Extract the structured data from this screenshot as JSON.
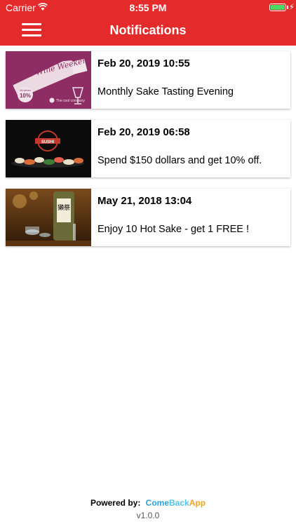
{
  "status_bar": {
    "carrier": "Carrier",
    "time": "8:55 PM",
    "battery_color": "#4cd964"
  },
  "header": {
    "title": "Notifications",
    "menu_icon": "hamburger-menu-icon",
    "background": "#e42a2a"
  },
  "notifications": [
    {
      "date": "Feb 20, 2019 10:55",
      "text": "Monthly Sake Tasting Evening",
      "image": "wine-promo-image",
      "image_text": {
        "headline": "Wild Wine Weekend",
        "discount": "10%",
        "discount_prefix": "All wines",
        "company": "The cool company"
      }
    },
    {
      "date": "Feb 20, 2019 06:58",
      "text": "Spend $150 dollars and get 10% off.",
      "image": "sushi-image",
      "image_text": {
        "logo": "SUSHI"
      }
    },
    {
      "date": "May 21, 2018 13:04",
      "text": "Enjoy 10 Hot Sake - get 1 FREE !",
      "image": "sake-bottle-image",
      "image_text": {
        "label": "獺祭"
      }
    }
  ],
  "footer": {
    "powered_by": "Powered by:",
    "brand_part1": "Come",
    "brand_part2": "Back",
    "brand_part3": "App",
    "version": "v1.0.0"
  }
}
